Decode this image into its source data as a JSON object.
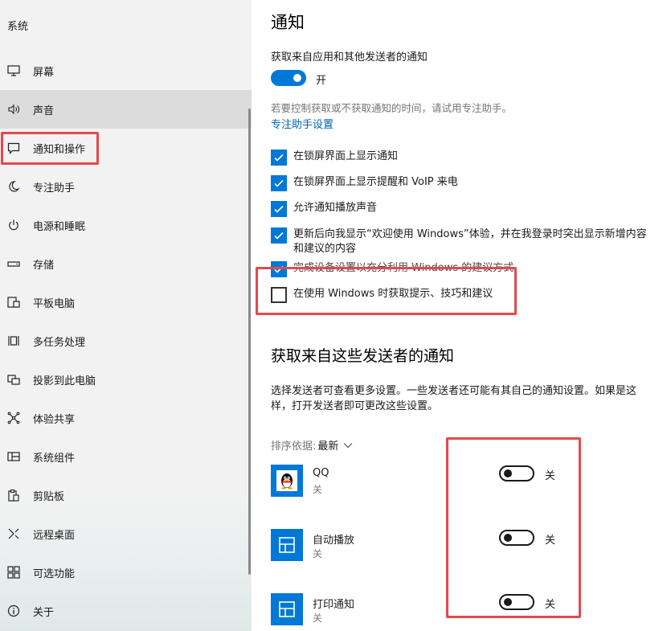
{
  "sidebar": {
    "title": "系统",
    "items": [
      {
        "label": "屏幕",
        "icon": "display-icon",
        "selected": false
      },
      {
        "label": "声音",
        "icon": "speaker-icon",
        "selected": true
      },
      {
        "label": "通知和操作",
        "icon": "notification-icon",
        "selected": false
      },
      {
        "label": "专注助手",
        "icon": "moon-icon",
        "selected": false
      },
      {
        "label": "电源和睡眠",
        "icon": "power-icon",
        "selected": false
      },
      {
        "label": "存储",
        "icon": "storage-icon",
        "selected": false
      },
      {
        "label": "平板电脑",
        "icon": "tablet-icon",
        "selected": false
      },
      {
        "label": "多任务处理",
        "icon": "multitask-icon",
        "selected": false
      },
      {
        "label": "投影到此电脑",
        "icon": "project-icon",
        "selected": false
      },
      {
        "label": "体验共享",
        "icon": "share-icon",
        "selected": false
      },
      {
        "label": "系统组件",
        "icon": "components-icon",
        "selected": false
      },
      {
        "label": "剪贴板",
        "icon": "clipboard-icon",
        "selected": false
      },
      {
        "label": "远程桌面",
        "icon": "remote-desktop-icon",
        "selected": false
      },
      {
        "label": "可选功能",
        "icon": "optional-features-icon",
        "selected": false
      },
      {
        "label": "关于",
        "icon": "info-icon",
        "selected": false
      }
    ]
  },
  "main": {
    "title": "通知",
    "get_notifications_label": "获取来自应用和其他发送者的通知",
    "get_notifications_state": "开",
    "focus_hint": "若要控制获取或不获取通知的时间，请试用专注助手。",
    "focus_link": "专注助手设置",
    "checkboxes": [
      {
        "label": "在锁屏界面上显示通知",
        "checked": true
      },
      {
        "label": "在锁屏界面上显示提醒和 VoIP 来电",
        "checked": true
      },
      {
        "label": "允许通知播放声音",
        "checked": true
      },
      {
        "label": "更新后向我显示“欢迎使用 Windows”体验，并在我登录时突出显示新增内容和建议的内容",
        "checked": true
      },
      {
        "label": "完成设备设置以充分利用 Windows 的建议方式",
        "checked": true
      },
      {
        "label": "在使用 Windows 时获取提示、技巧和建议",
        "checked": false
      }
    ],
    "senders_title": "获取来自这些发送者的通知",
    "senders_desc": "选择发送者可查看更多设置。一些发送者还可能有其自己的通知设置。如果是这样，打开发送者即可更改这些设置。",
    "sort_label": "排序依据:",
    "sort_value": "最新",
    "senders": [
      {
        "name": "QQ",
        "status": "关",
        "toggle": "关",
        "icon": "qq-penguin-icon",
        "on": false
      },
      {
        "name": "自动播放",
        "status": "关",
        "toggle": "关",
        "icon": "autoplay-icon",
        "on": false
      },
      {
        "name": "打印通知",
        "status": "关",
        "toggle": "关",
        "icon": "print-notification-icon",
        "on": false
      }
    ]
  },
  "colors": {
    "accent": "#0078d7",
    "link": "#0063b1",
    "highlight": "#e5484d",
    "sidebar_bg": "#f2f2f2"
  }
}
